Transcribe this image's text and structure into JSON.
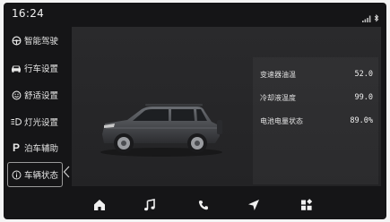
{
  "status_bar": {
    "time": "16:24",
    "icons": [
      "signal-icon",
      "bluetooth-icon"
    ]
  },
  "sidebar": {
    "items": [
      {
        "label": "智能驾驶",
        "icon": "steering-wheel-icon",
        "active": false
      },
      {
        "label": "行车设置",
        "icon": "car-icon",
        "active": false
      },
      {
        "label": "舒适设置",
        "icon": "smile-icon",
        "active": false
      },
      {
        "label": "灯光设置",
        "icon": "headlight-icon",
        "active": false
      },
      {
        "label": "泊车辅助",
        "icon": "parking-icon",
        "active": false
      },
      {
        "label": "车辆状态",
        "icon": "info-icon",
        "active": true
      }
    ]
  },
  "vehicle_status": {
    "rows": [
      {
        "label": "变速器油温",
        "value": "52.0"
      },
      {
        "label": "冷却液温度",
        "value": "99.0"
      },
      {
        "label": "电池电量状态",
        "value": "89.0%"
      }
    ]
  },
  "dock": {
    "buttons": [
      {
        "icon": "home-icon"
      },
      {
        "icon": "music-icon"
      },
      {
        "icon": "phone-icon"
      },
      {
        "icon": "navigation-icon"
      },
      {
        "icon": "apps-icon"
      }
    ]
  },
  "colors": {
    "background": "#151517",
    "panel": "#2a2a2c",
    "text": "#e6e6e6"
  }
}
